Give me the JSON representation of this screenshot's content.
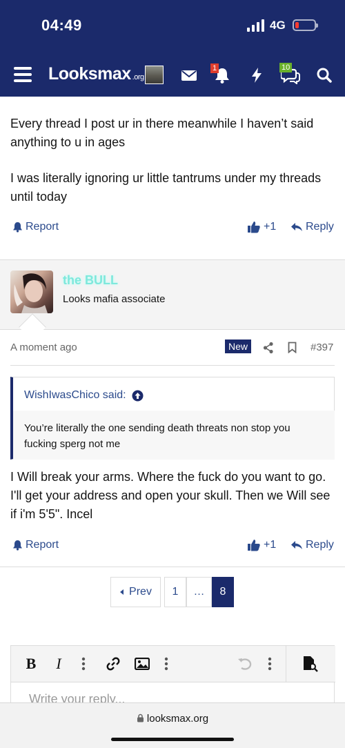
{
  "status_bar": {
    "time": "04:49",
    "network": "4G"
  },
  "navbar": {
    "logo_main": "Looksmax",
    "logo_tld": ".org",
    "alerts_badge": "1",
    "conversations_badge": "10"
  },
  "post_prev": {
    "paragraphs": [
      "Every thread I post ur in there meanwhile I haven’t said anything to u in ages",
      "I was literally ignoring ur little tantrums under my threads until today"
    ],
    "report_label": "Report",
    "like_label": "+1",
    "reply_label": "Reply"
  },
  "post": {
    "username": "the BULL",
    "user_title": "Looks mafia associate",
    "time": "A moment ago",
    "new_badge": "New",
    "post_number": "#397",
    "quote": {
      "author": "WishIwasChico said:",
      "text": "You’re literally the one sending death threats non stop you fucking sperg not me"
    },
    "body": "I Will break your arms. Where the fuck do you want to go. I'll get your address and open your skull. Then we Will see if i'm 5'5\". Incel",
    "report_label": "Report",
    "like_label": "+1",
    "reply_label": "Reply"
  },
  "pagination": {
    "prev_label": "Prev",
    "pages": [
      "1",
      "…",
      "8"
    ],
    "current_page": "8"
  },
  "editor": {
    "placeholder": "Write your reply..."
  },
  "browser": {
    "url": "looksmax.org"
  },
  "colors": {
    "brand_navy": "#1b2a6b",
    "link_blue": "#2b4a8c",
    "username_teal": "#7ee8dc"
  }
}
